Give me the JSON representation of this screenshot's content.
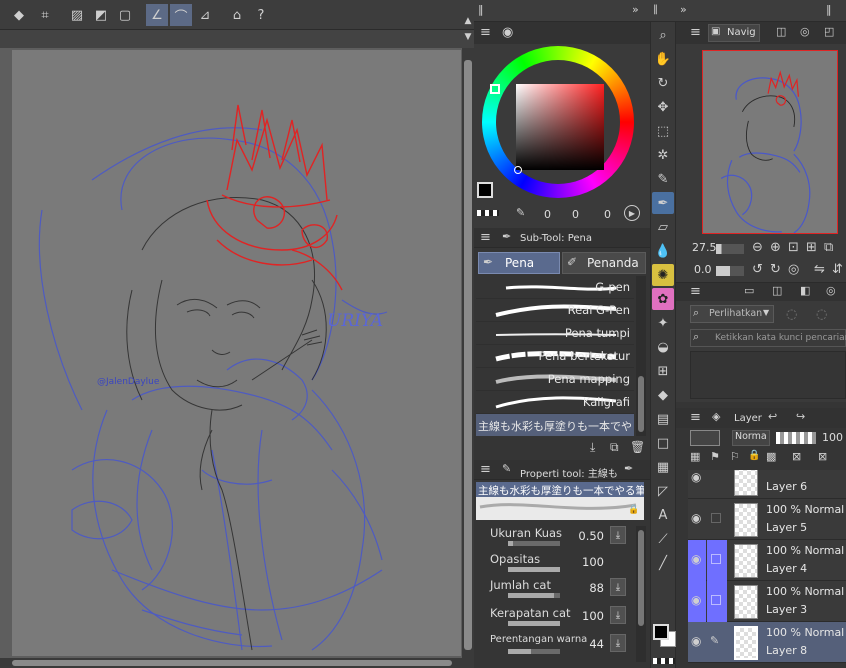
{
  "colors": {
    "canvas_bg": "#7a7a7a",
    "panel_bg": "#3a3a3a",
    "accent": "#6f6fff",
    "selected_layer": "#55607a",
    "sketch_blue": "#4a58c9",
    "sketch_red": "#e02424"
  },
  "navigator": {
    "tab_label": "Navig"
  },
  "nav_controls": {
    "zoom": "27.5",
    "rotation": "0.0"
  },
  "subtool": {
    "tab_label": "Sub-Tool: Pena",
    "tabs": [
      "Pena",
      "Penanda"
    ],
    "brushes": [
      "G-pen",
      "Real G-Pen",
      "Pena tumpi",
      "Pena bertekstur",
      "Pena mapping",
      "Kaligrafi",
      "主線も水彩も厚塗りも一本でや"
    ]
  },
  "tool_property": {
    "tab_label": "Properti tool: 主線も",
    "preview_text": "主線も水彩も厚塗りも一本でやる筆けものブラ",
    "props": [
      {
        "label": "Ukuran Kuas",
        "value": "0.50"
      },
      {
        "label": "Opasitas",
        "value": "100"
      },
      {
        "label": "Jumlah cat",
        "value": "88"
      },
      {
        "label": "Kerapatan cat",
        "value": "100"
      },
      {
        "label": "Perentangan warna",
        "value": "44"
      }
    ]
  },
  "color_wheel": {
    "values": [
      "0",
      "0",
      "0"
    ],
    "main_color": "#000000",
    "sub_color": "#ffffff"
  },
  "search": {
    "filter_label": "Perlihatkan",
    "placeholder": "Ketikkan kata kunci pencarian"
  },
  "layer_panel": {
    "tab_label": "Layer",
    "blend_mode": "Norma",
    "opacity": "100",
    "layers": [
      {
        "mode": "",
        "name": "Layer 6",
        "visible": true,
        "color": false,
        "selected": false
      },
      {
        "mode": "100 % Normal",
        "name": "Layer 5",
        "visible": true,
        "color": false,
        "selected": false
      },
      {
        "mode": "100 % Normal",
        "name": "Layer 4",
        "visible": true,
        "color": true,
        "selected": false
      },
      {
        "mode": "100 % Normal",
        "name": "Layer 3",
        "visible": true,
        "color": true,
        "selected": false
      },
      {
        "mode": "100 % Normal",
        "name": "Layer 8",
        "visible": true,
        "color": false,
        "selected": true
      }
    ]
  },
  "canvas": {
    "signature": "@JalenDaylue",
    "doodle_text": "URIYA"
  }
}
